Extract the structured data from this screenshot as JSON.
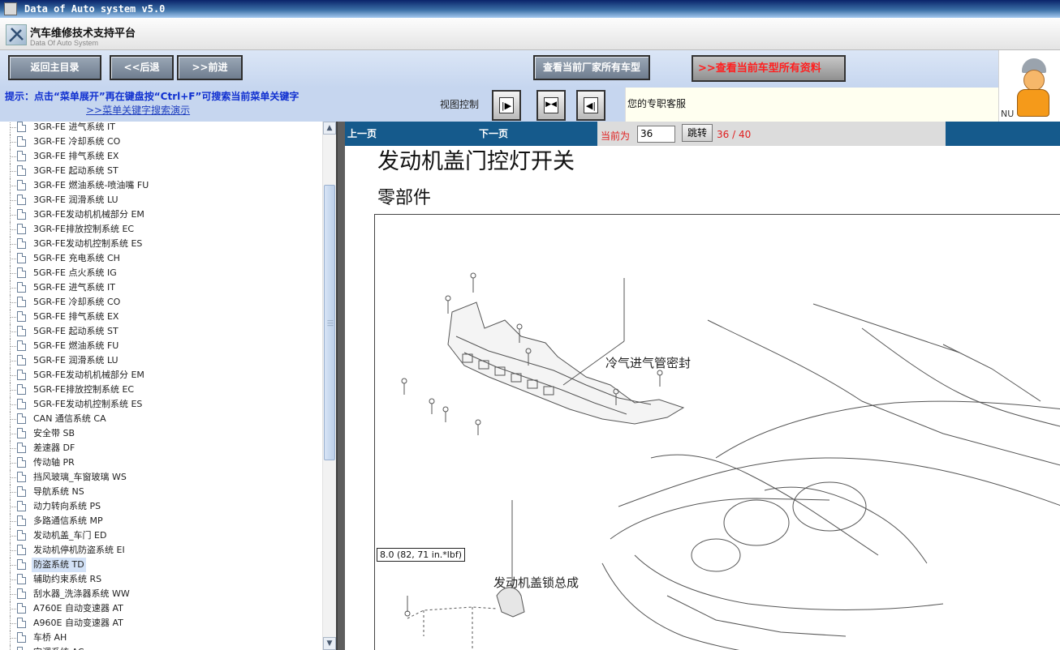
{
  "window": {
    "title": "Data of Auto system v5.0"
  },
  "header": {
    "title": "汽车维修技术支持平台",
    "subtitle": "Data Of Auto System"
  },
  "nav": {
    "home_label": "返回主目录",
    "back_label": "<<后退",
    "forward_label": ">>前进",
    "all_models_label": "查看当前厂家所有车型",
    "all_data_label": "查看当前车型所有资料",
    "all_data_prefix": ">>"
  },
  "tip": {
    "text": "提示：点击“菜单展开”再在键盘按“Ctrl+F”可搜索当前菜单关键字",
    "link": ">>菜单关键字搜索演示"
  },
  "view_control": {
    "label": "视图控制"
  },
  "service": {
    "label": "您的专职客服"
  },
  "mascot": {
    "partial_text": "NU"
  },
  "tree_items": [
    {
      "label": "3GR-FE 进气系统  IT"
    },
    {
      "label": "3GR-FE 冷却系统  CO"
    },
    {
      "label": "3GR-FE 排气系统  EX"
    },
    {
      "label": "3GR-FE 起动系统  ST"
    },
    {
      "label": "3GR-FE 燃油系统-喷油嘴  FU"
    },
    {
      "label": "3GR-FE 润滑系统  LU"
    },
    {
      "label": "3GR-FE发动机机械部分  EM"
    },
    {
      "label": "3GR-FE排放控制系统  EC"
    },
    {
      "label": "3GR-FE发动机控制系统  ES"
    },
    {
      "label": "5GR-FE 充电系统  CH"
    },
    {
      "label": "5GR-FE 点火系统  IG"
    },
    {
      "label": "5GR-FE 进气系统  IT"
    },
    {
      "label": "5GR-FE 冷却系统  CO"
    },
    {
      "label": "5GR-FE 排气系统  EX"
    },
    {
      "label": "5GR-FE 起动系统  ST"
    },
    {
      "label": "5GR-FE 燃油系统  FU"
    },
    {
      "label": "5GR-FE 润滑系统  LU"
    },
    {
      "label": "5GR-FE发动机机械部分  EM"
    },
    {
      "label": "5GR-FE排放控制系统  EC"
    },
    {
      "label": "5GR-FE发动机控制系统  ES"
    },
    {
      "label": "CAN 通信系统  CA"
    },
    {
      "label": "安全带  SB"
    },
    {
      "label": "差速器  DF"
    },
    {
      "label": "传动轴  PR"
    },
    {
      "label": "挡风玻璃_车窗玻璃  WS"
    },
    {
      "label": "导航系统  NS"
    },
    {
      "label": "动力转向系统  PS"
    },
    {
      "label": "多路通信系统  MP"
    },
    {
      "label": "发动机盖_车门  ED"
    },
    {
      "label": "发动机停机防盗系统  EI"
    },
    {
      "label": "防盗系统  TD",
      "selected": true
    },
    {
      "label": "辅助约束系统  RS"
    },
    {
      "label": "刮水器_洗涤器系统  WW"
    },
    {
      "label": "A760E 自动变速器  AT"
    },
    {
      "label": "A960E 自动变速器  AT"
    },
    {
      "label": "车桥  AH"
    },
    {
      "label": "空调系统  AC"
    }
  ],
  "pager": {
    "prev_label": "上一页",
    "next_label": "下一页",
    "current_label": "当前为",
    "page_value": "36",
    "jump_label": "跳转",
    "count": "36 / 40"
  },
  "document": {
    "title": "发动机盖门控灯开关",
    "subtitle": "零部件",
    "callout_seal": "冷气进气管密封",
    "callout_lock": "发动机盖锁总成",
    "torque_spec": "8.0 (82, 71 in.*lbf)"
  },
  "colors": {
    "titlebar": "#0a246a",
    "pagebar": "#155a8c",
    "tip_text": "#1030d0",
    "red_text": "#ff1f1f",
    "splitter": "#5e5e5e"
  }
}
